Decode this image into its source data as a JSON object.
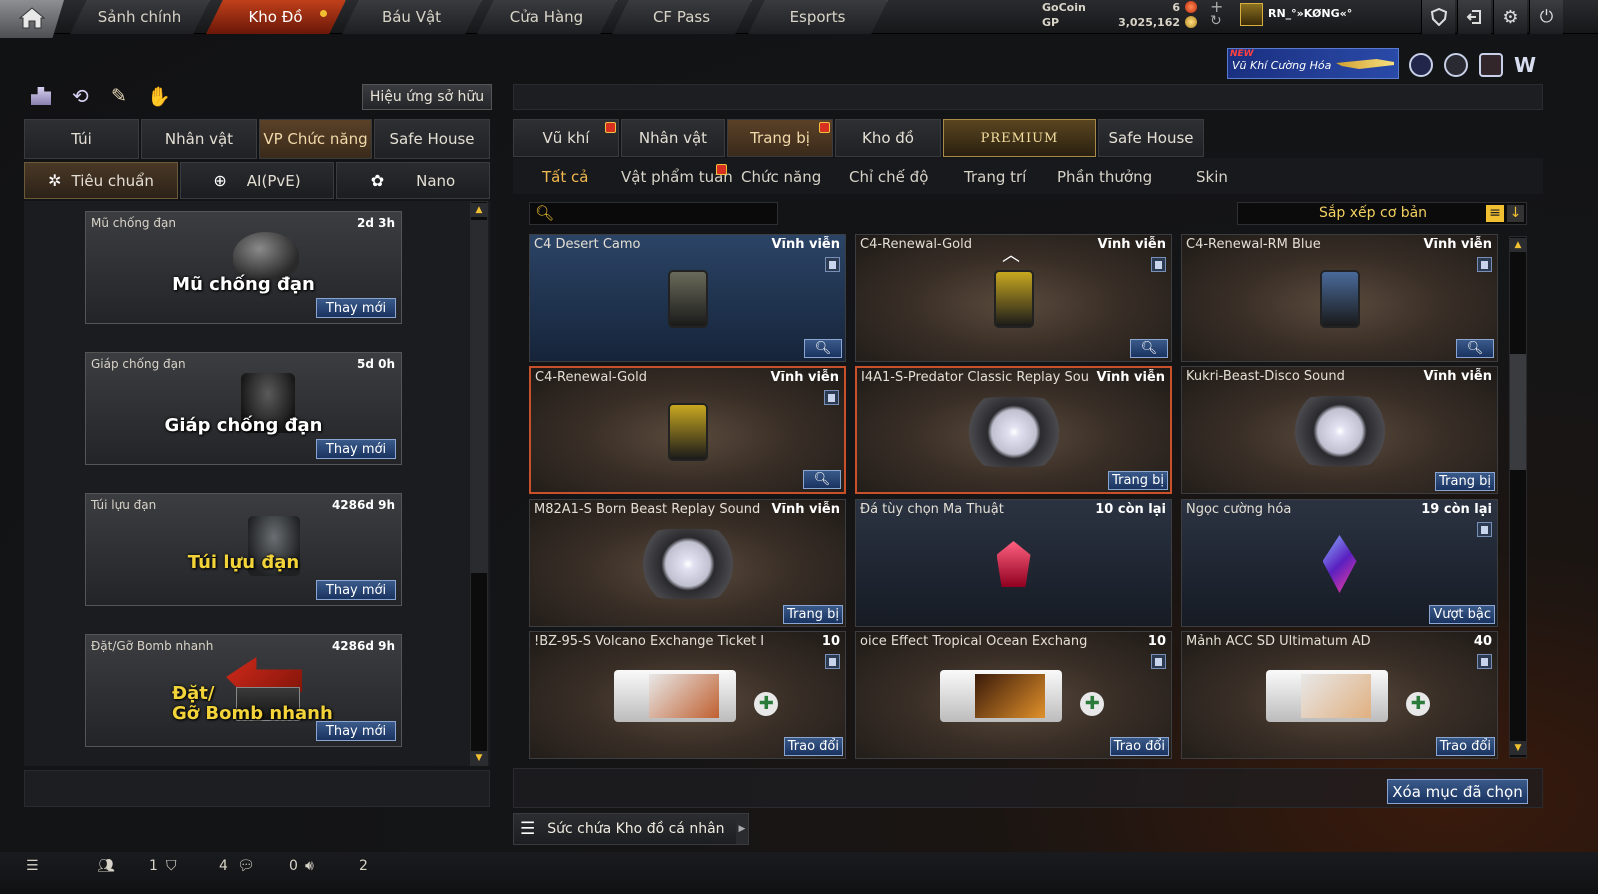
{
  "nav": {
    "tabs": [
      {
        "label": "Sảnh chính"
      },
      {
        "label": "Kho Đồ"
      },
      {
        "label": "Báu Vật"
      },
      {
        "label": "Cửa Hàng"
      },
      {
        "label": "CF Pass"
      },
      {
        "label": "Esports"
      }
    ],
    "active_tab": "Kho Đồ"
  },
  "currency": {
    "gocoin_label": "GoCoin",
    "gocoin_value": "6",
    "gp_label": "GP",
    "gp_value": "3,025,162"
  },
  "user": {
    "name": "RN_°»KØNG«°"
  },
  "banner": {
    "new": "NEW",
    "text": "Vũ Khí Cường Hóa"
  },
  "left_panel": {
    "effect_button": "Hiệu ứng sở hữu",
    "tabs": [
      "Túi",
      "Nhân vật",
      "VP Chức năng",
      "Safe House"
    ],
    "active_tab": "VP Chức năng",
    "subtabs": [
      "Tiêu chuẩn",
      "AI(PvE)",
      "Nano"
    ],
    "active_subtab": "Tiêu chuẩn",
    "equipment": [
      {
        "name": "Mũ chống đạn",
        "time": "2d 3h",
        "big": "Mũ chống đạn",
        "action": "Thay mới"
      },
      {
        "name": "Giáp chống đạn",
        "time": "5d 0h",
        "big": "Giáp chống đạn",
        "action": "Thay mới"
      },
      {
        "name": "Túi lựu đạn",
        "time": "4286d 9h",
        "big": "Túi lựu đạn",
        "action": "Thay mới"
      },
      {
        "name": "Đặt/Gỡ Bomb nhanh",
        "time": "4286d 9h",
        "big_line1": "Đặt/",
        "big_line2": "Gỡ Bomb nhanh",
        "action": "Thay mới"
      }
    ]
  },
  "right_panel": {
    "tabs": [
      "Vũ khí",
      "Nhân vật",
      "Trang bị",
      "Kho đồ",
      "PREMIUM",
      "Safe House"
    ],
    "active_tab": "Trang bị",
    "subtabs": [
      "Tất cả",
      "Vật phẩm tuần",
      "Chức năng",
      "Chỉ chế độ",
      "Trang trí",
      "Phần thưởng",
      "Skin"
    ],
    "active_subtab": "Tất cả",
    "search_placeholder": "",
    "sort_label": "Sắp xếp cơ bản",
    "items": [
      {
        "name": "C4 Desert Camo",
        "duration": "Vĩnh viễn",
        "action": "",
        "style": "blue"
      },
      {
        "name": "C4-Renewal-Gold",
        "duration": "Vĩnh viễn",
        "action": "",
        "style": "brown"
      },
      {
        "name": "C4-Renewal-RM Blue",
        "duration": "Vĩnh viễn",
        "action": "",
        "style": "brown"
      },
      {
        "name": "C4-Renewal-Gold",
        "duration": "Vĩnh viễn",
        "action": "",
        "style": "brown"
      },
      {
        "name": "I4A1-S-Predator Classic Replay Sou",
        "duration": "Vĩnh viễn",
        "action": "Trang bị",
        "style": "brown"
      },
      {
        "name": "Kukri-Beast-Disco Sound",
        "duration": "Vĩnh viễn",
        "action": "Trang bị",
        "style": "brown"
      },
      {
        "name": "M82A1-S Born Beast Replay Sound",
        "duration": "Vĩnh viễn",
        "action": "Trang bị",
        "style": "brown"
      },
      {
        "name": "Đá tùy chọn Ma Thuật",
        "duration": "10 còn lại",
        "action": "",
        "style": "dark"
      },
      {
        "name": "Ngọc cường hóa",
        "duration": "19 còn lại",
        "action": "Vượt bậc",
        "style": "dark"
      },
      {
        "name": "!BZ-95-S Volcano Exchange Ticket I",
        "duration": "10",
        "action": "Trao đổi",
        "style": "brown"
      },
      {
        "name": "oice Effect Tropical Ocean Exchang",
        "duration": "10",
        "action": "Trao đổi",
        "style": "brown"
      },
      {
        "name": "Mảnh ACC SD Ultimatum AD",
        "duration": "40",
        "action": "Trao đổi",
        "style": "brown"
      }
    ],
    "delete_button": "Xóa mục đã chọn",
    "capacity_label": "Sức chứa Kho đồ cá nhân"
  },
  "status_bar": {
    "friends": "1",
    "clan": "4",
    "chat": "0",
    "voice": "2"
  },
  "colors": {
    "accent_red": "#c0401a",
    "button_blue": "#1a3360",
    "highlight_gold": "#f0b850"
  }
}
